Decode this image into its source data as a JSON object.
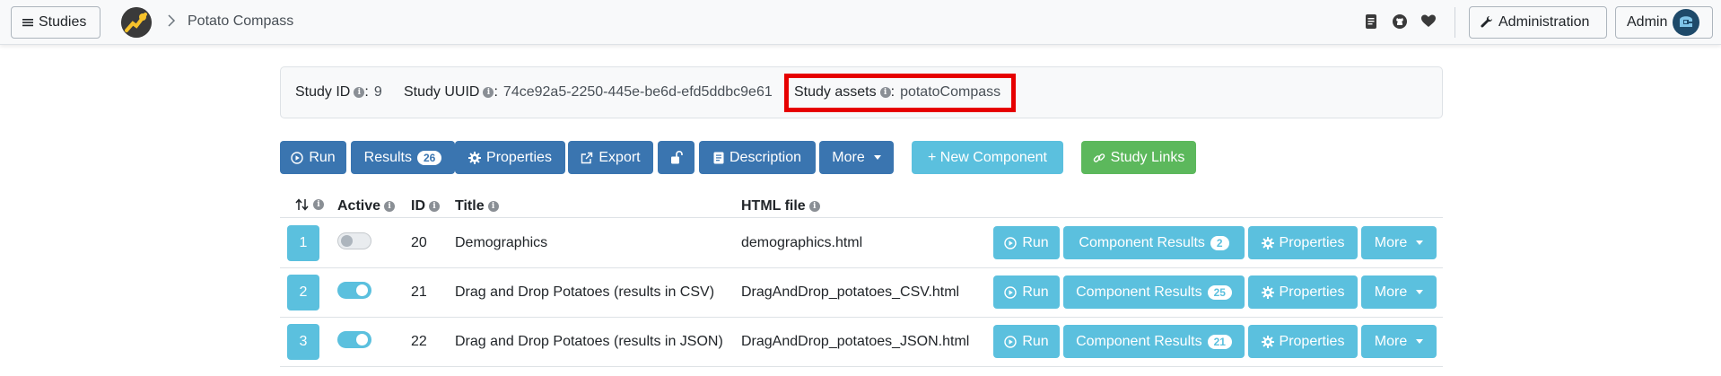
{
  "navbar": {
    "studies_label": "Studies",
    "breadcrumb": "Potato Compass",
    "administration_label": "Administration",
    "user_label": "Admin",
    "icons": [
      "document-icon",
      "github-icon",
      "heart-icon"
    ]
  },
  "study_info": {
    "id_label": "Study ID",
    "id_value": "9",
    "uuid_label": "Study UUID",
    "uuid_value": "74ce92a5-2250-445e-be6d-efd5ddbc9e61",
    "assets_label": "Study assets",
    "assets_value": "potatoCompass",
    "highlight_color": "#e60000"
  },
  "toolbar": {
    "run": "Run",
    "results": "Results",
    "results_count": "26",
    "properties": "Properties",
    "export": "Export",
    "description": "Description",
    "more": "More",
    "new_component": "+ New Component",
    "study_links": "Study Links"
  },
  "table": {
    "headers": {
      "order": "",
      "active": "Active",
      "id": "ID",
      "title": "Title",
      "html_file": "HTML file"
    },
    "rows": [
      {
        "position": "1",
        "active": false,
        "id": "20",
        "title": "Demographics",
        "html_file": "demographics.html",
        "results_count": "2"
      },
      {
        "position": "2",
        "active": true,
        "id": "21",
        "title": "Drag and Drop Potatoes (results in CSV)",
        "html_file": "DragAndDrop_potatoes_CSV.html",
        "results_count": "25"
      },
      {
        "position": "3",
        "active": true,
        "id": "22",
        "title": "Drag and Drop Potatoes (results in JSON)",
        "html_file": "DragAndDrop_potatoes_JSON.html",
        "results_count": "21"
      }
    ],
    "row_actions": {
      "run": "Run",
      "component_results": "Component Results",
      "properties": "Properties",
      "more": "More"
    }
  },
  "colors": {
    "primary": "#3a75b0",
    "info": "#5bc0de",
    "success": "#5cb85c"
  }
}
